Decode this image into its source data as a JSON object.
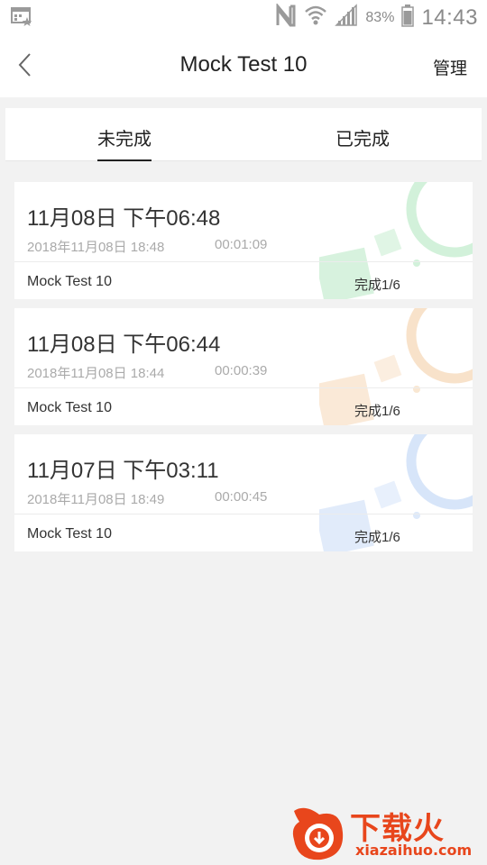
{
  "status_bar": {
    "battery_percent": "83%",
    "time": "14:43",
    "icons": [
      "screenshot-icon",
      "nfc-icon",
      "wifi-icon",
      "signal-icon",
      "battery-icon"
    ]
  },
  "header": {
    "title": "Mock Test 10",
    "manage_label": "管理"
  },
  "tabs": [
    {
      "label": "未完成",
      "active": true
    },
    {
      "label": "已完成",
      "active": false
    }
  ],
  "cards": [
    {
      "title": "11月08日 下午06:48",
      "date": "2018年11月08日 18:48",
      "duration": "00:01:09",
      "name": "Mock Test 10",
      "progress": "完成1/6",
      "accent": "#a6e3b5"
    },
    {
      "title": "11月08日 下午06:44",
      "date": "2018年11月08日 18:44",
      "duration": "00:00:39",
      "name": "Mock Test 10",
      "progress": "完成1/6",
      "accent": "#f3cfa6"
    },
    {
      "title": "11月07日 下午03:11",
      "date": "2018年11月08日 18:49",
      "duration": "00:00:45",
      "name": "Mock Test 10",
      "progress": "完成1/6",
      "accent": "#bcd3f5"
    }
  ],
  "watermark": {
    "text": "下载火",
    "url": "xiazaihuo.com",
    "color": "#e8461c"
  }
}
